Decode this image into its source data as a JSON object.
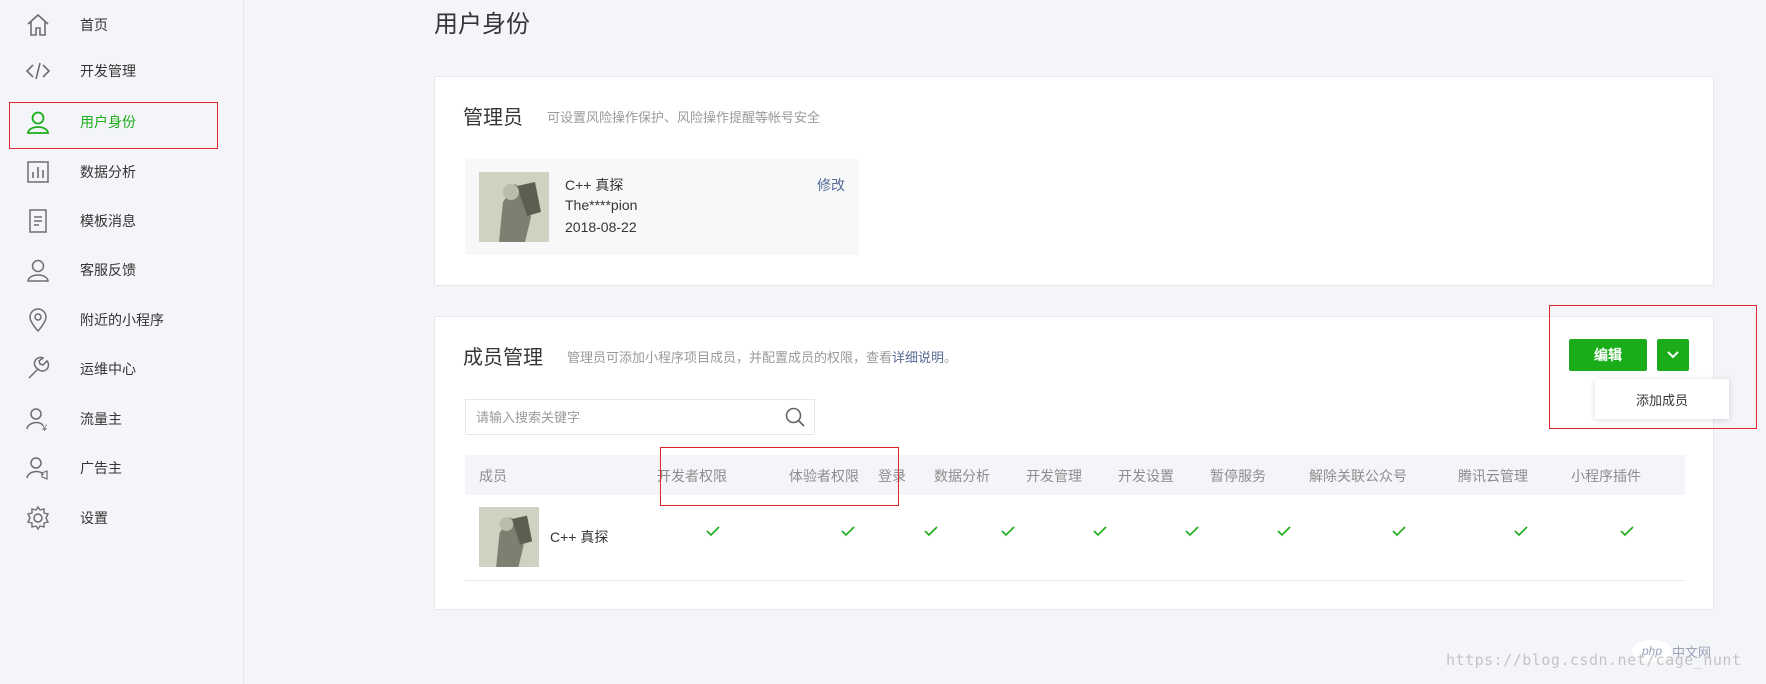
{
  "sidebar": {
    "items": [
      {
        "label": "首页",
        "icon": "home-icon"
      },
      {
        "label": "开发管理",
        "icon": "code-icon"
      },
      {
        "label": "用户身份",
        "icon": "user-icon",
        "active": true
      },
      {
        "label": "数据分析",
        "icon": "chart-icon"
      },
      {
        "label": "模板消息",
        "icon": "document-icon"
      },
      {
        "label": "客服反馈",
        "icon": "service-icon"
      },
      {
        "label": "附近的小程序",
        "icon": "location-icon"
      },
      {
        "label": "运维中心",
        "icon": "wrench-icon"
      },
      {
        "label": "流量主",
        "icon": "traffic-icon"
      },
      {
        "label": "广告主",
        "icon": "advertiser-icon"
      },
      {
        "label": "设置",
        "icon": "gear-icon"
      }
    ]
  },
  "page": {
    "title": "用户身份"
  },
  "admin": {
    "title": "管理员",
    "desc": "可设置风险操作保护、风险操作提醒等帐号安全",
    "name": "C++ 真探",
    "account": "The****pion",
    "date": "2018-08-22",
    "modify_label": "修改"
  },
  "members": {
    "title": "成员管理",
    "desc_prefix": "管理员可添加小程序项目成员，并配置成员的权限，查看",
    "desc_link": "详细说明",
    "desc_suffix": "。",
    "edit_label": "编辑",
    "dropdown_item": "添加成员",
    "search_placeholder": "请输入搜索关键字",
    "columns": [
      "成员",
      "开发者权限",
      "体验者权限",
      "登录",
      "数据分析",
      "开发管理",
      "开发设置",
      "暂停服务",
      "解除关联公众号",
      "腾讯云管理",
      "小程序插件"
    ],
    "rows": [
      {
        "name": "C++ 真探",
        "permissions": [
          true,
          true,
          true,
          true,
          true,
          true,
          true,
          true,
          true,
          true
        ]
      }
    ]
  },
  "watermark": {
    "text": "https://blog.csdn.net/cage_hunt",
    "logo": "php",
    "logo_cn": "中文网"
  },
  "colors": {
    "accent": "#1aad19",
    "link": "#576b95",
    "highlight": "#e0262d"
  }
}
